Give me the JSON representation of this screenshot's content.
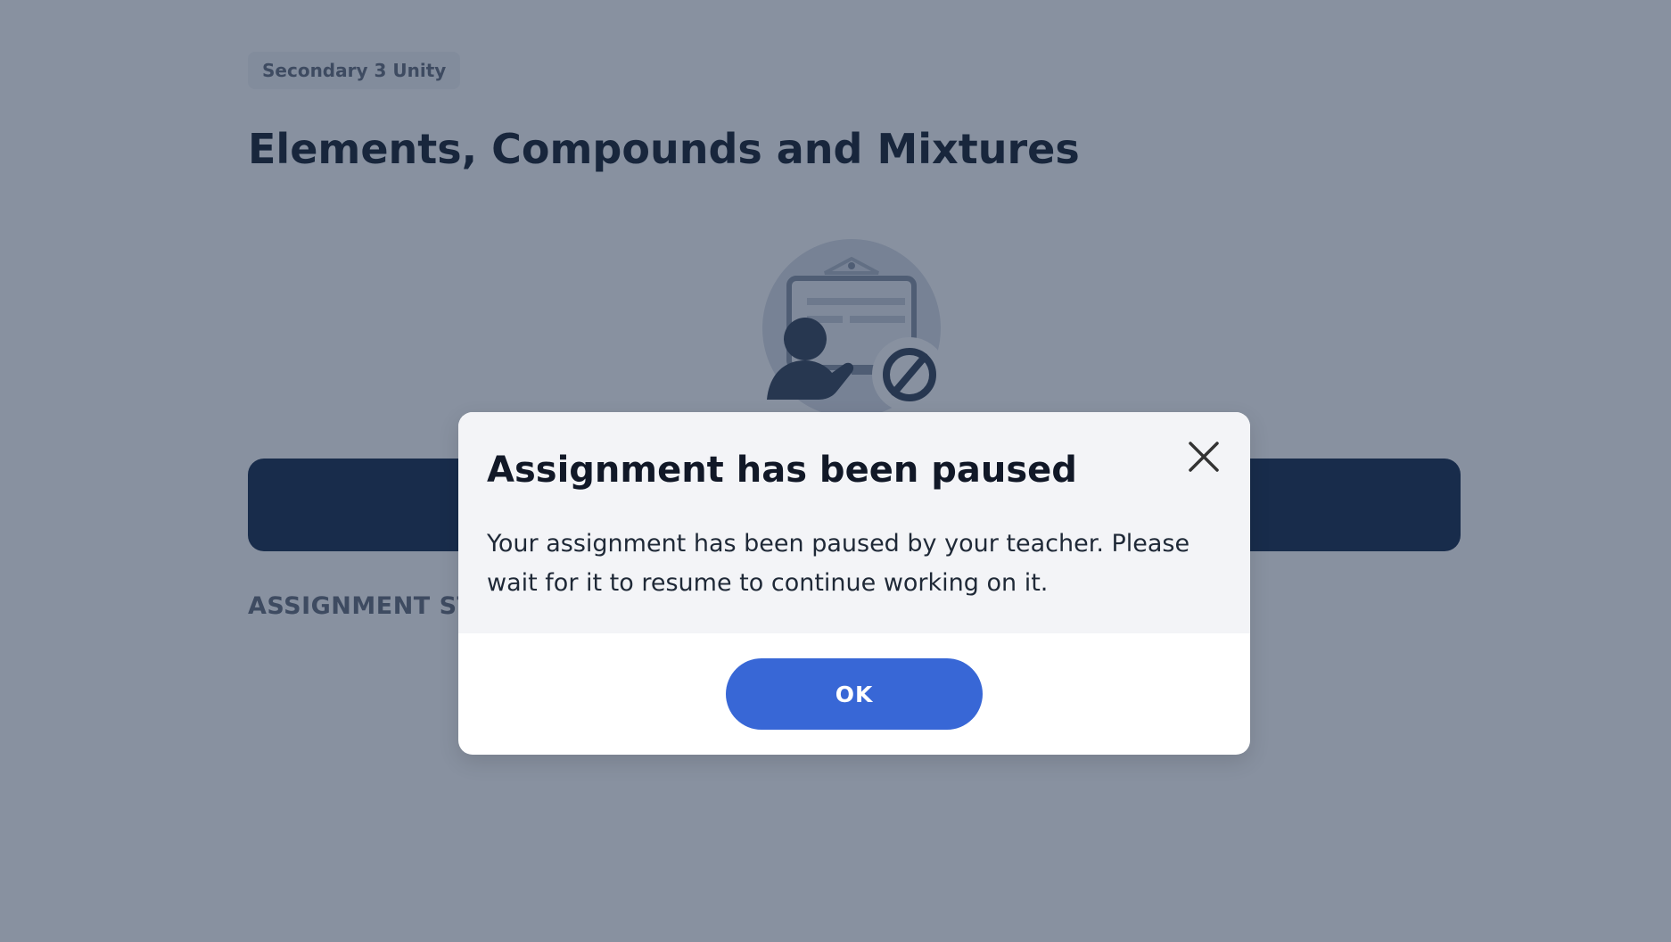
{
  "page": {
    "class_tag": "Secondary 3 Unity",
    "title": "Elements, Compounds and Mixtures",
    "section_heading": "ASSIGNMENT STATUS",
    "illustration_icon": "paused-assignment-illustration",
    "colors": {
      "primary_button": "#1f3454",
      "overlay": "rgba(17, 35, 66, 0.5)"
    }
  },
  "dialog": {
    "title": "Assignment has been paused",
    "message": "Your assignment has been paused by your teacher. Please wait for it to resume to continue working on it.",
    "close_icon": "close-icon",
    "ok_label": "OK",
    "colors": {
      "header_bg": "#f3f4f7",
      "ok_button": "#3867d6"
    }
  }
}
